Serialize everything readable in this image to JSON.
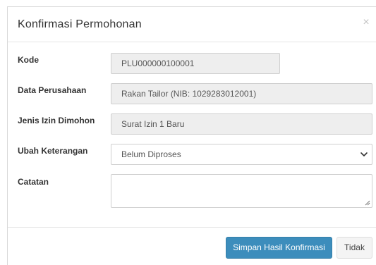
{
  "modal": {
    "title": "Konfirmasi Permohonan",
    "close_symbol": "×"
  },
  "form": {
    "kode": {
      "label": "Kode",
      "value": "PLU000000100001"
    },
    "data_perusahaan": {
      "label": "Data Perusahaan",
      "value": "Rakan Tailor (NIB: 1029283012001)"
    },
    "jenis_izin": {
      "label": "Jenis Izin Dimohon",
      "value": "Surat Izin 1 Baru"
    },
    "ubah_keterangan": {
      "label": "Ubah Keterangan",
      "selected": "Belum Diproses"
    },
    "catatan": {
      "label": "Catatan",
      "value": ""
    }
  },
  "footer": {
    "submit_label": "Simpan Hasil Konfirmasi",
    "cancel_label": "Tidak"
  },
  "icons": {
    "close": "close-icon",
    "select": "chevron-down-icon",
    "textarea": "resize-grip-icon"
  },
  "colors": {
    "primary": "#3c8dbc",
    "readonly_bg": "#eeeeee"
  }
}
